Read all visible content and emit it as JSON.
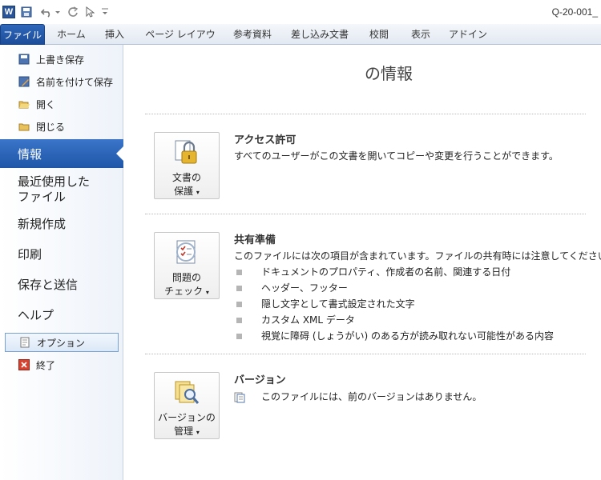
{
  "window": {
    "title": "Q-20-001_"
  },
  "quick_access": {
    "icons": [
      "word-logo-icon",
      "save-icon",
      "undo-icon",
      "redo-icon",
      "pointer-icon",
      "customize-icon"
    ],
    "word_logo": "W"
  },
  "ribbon": {
    "tabs": [
      {
        "label": "ファイル",
        "active": true
      },
      {
        "label": "ホーム"
      },
      {
        "label": "挿入"
      },
      {
        "label": "ページ レイアウト"
      },
      {
        "label": "参考資料"
      },
      {
        "label": "差し込み文書"
      },
      {
        "label": "校閲"
      },
      {
        "label": "表示"
      },
      {
        "label": "アドイン"
      }
    ]
  },
  "nav": {
    "commands": [
      {
        "label": "上書き保存",
        "icon": "save-icon"
      },
      {
        "label": "名前を付けて保存",
        "icon": "save-as-icon"
      },
      {
        "label": "開く",
        "icon": "open-folder-icon"
      },
      {
        "label": "閉じる",
        "icon": "close-folder-icon"
      }
    ],
    "info": "情報",
    "recent": [
      "最近使用した",
      "ファイル"
    ],
    "new": "新規作成",
    "print": "印刷",
    "save_send": "保存と送信",
    "help": "ヘルプ",
    "options": "オプション",
    "exit": "終了"
  },
  "main": {
    "title": "の情報",
    "permissions": {
      "button": [
        "文書の",
        "保護"
      ],
      "title": "アクセス許可",
      "text": "すべてのユーザーがこの文書を開いてコピーや変更を行うことができます。"
    },
    "prepare": {
      "button": [
        "問題の",
        "チェック"
      ],
      "title": "共有準備",
      "text": "このファイルには次の項目が含まれています。ファイルの共有時には注意してください。",
      "items": [
        "ドキュメントのプロパティ、作成者の名前、関連する日付",
        "ヘッダー、フッター",
        "隠し文字として書式設定された文字",
        "カスタム XML データ",
        "視覚に障碍 (しょうがい) のある方が読み取れない可能性がある内容"
      ]
    },
    "versions": {
      "button": [
        "バージョンの",
        "管理"
      ],
      "title": "バージョン",
      "text": "このファイルには、前のバージョンはありません。"
    }
  },
  "colors": {
    "accent": "#2a63b5",
    "nav_bg": "#eef3fa",
    "active": "#1f56a8"
  }
}
